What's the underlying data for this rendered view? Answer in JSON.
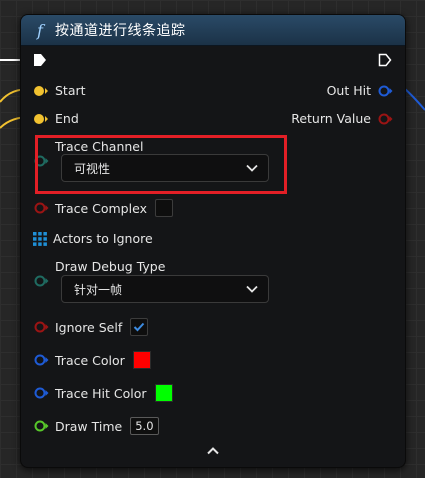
{
  "node": {
    "title": "按通道进行线条追踪",
    "function_icon": "f"
  },
  "pins": {
    "start": "Start",
    "end": "End",
    "out_hit": "Out Hit",
    "return_value": "Return Value",
    "trace_channel": "Trace Channel",
    "trace_channel_value": "可视性",
    "trace_complex": "Trace Complex",
    "actors_to_ignore": "Actors to Ignore",
    "draw_debug_type": "Draw Debug Type",
    "draw_debug_type_value": "针对一帧",
    "ignore_self": "Ignore Self",
    "trace_color": "Trace Color",
    "trace_hit_color": "Trace Hit Color",
    "draw_time": "Draw Time",
    "draw_time_value": "5.0"
  },
  "state": {
    "trace_complex_checked": false,
    "ignore_self_checked": true
  },
  "colors": {
    "trace_color": "#ff0000",
    "trace_hit_color": "#00ff00",
    "highlight": "#e21f26",
    "vector_pin": "#f2c230",
    "struct_pin": "#1e5bd6",
    "bool_pin": "#9b1414",
    "object_pin": "#1f8fd6",
    "byte_pin": "#1f6b61",
    "float_pin": "#57c72a"
  }
}
